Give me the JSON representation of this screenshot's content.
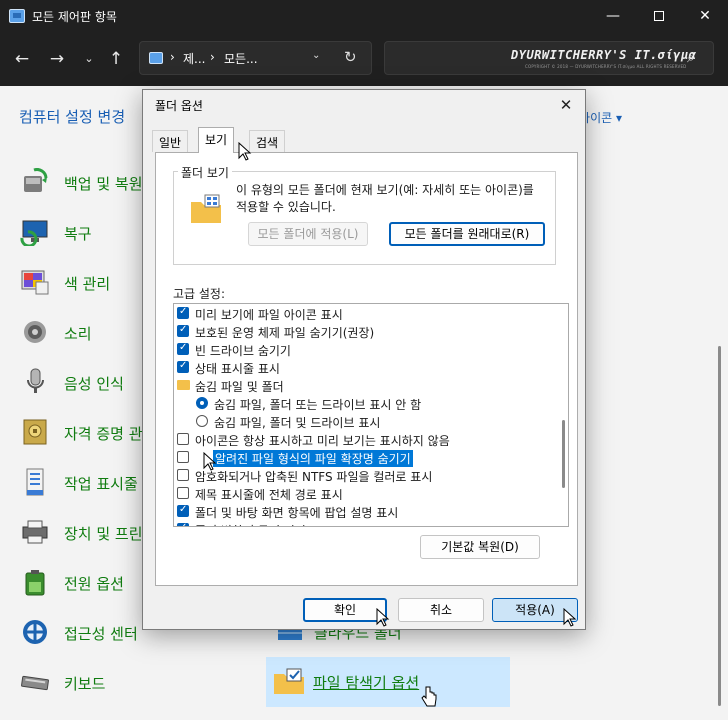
{
  "window": {
    "title": "모든 제어판 항목",
    "min_glyph": "—",
    "close_glyph": "✕"
  },
  "nav": {
    "back": "←",
    "forward": "→",
    "recent": "⌄",
    "up": "↑",
    "breadcrumb": [
      "제...",
      "모든..."
    ],
    "separator": "›",
    "dropdown": "⌄",
    "refresh": "↻",
    "search_text": "DYURWITCHERRY'S IT.σίγμα",
    "search_subtext": "COPYRIGHT © 2018 — DYURWITCHERRY'S IT.σίγμα ALL RIGHTS RESERVED",
    "search_glyph": "⌕"
  },
  "control_panel": {
    "heading": "컴퓨터 설정 변경",
    "view_by": "│ 아이콘 ▾",
    "items": [
      {
        "label": "백업 및 복원",
        "icon": "backup-icon"
      },
      {
        "label": "복구",
        "icon": "recovery-icon"
      },
      {
        "label": "색 관리",
        "icon": "color-management-icon"
      },
      {
        "label": "소리",
        "icon": "sound-icon"
      },
      {
        "label": "음성 인식",
        "icon": "microphone-icon"
      },
      {
        "label": "자격 증명 관리자",
        "icon": "credential-icon"
      },
      {
        "label": "작업 표시줄",
        "icon": "taskbar-icon"
      },
      {
        "label": "장치 및 프린터",
        "icon": "printer-icon"
      },
      {
        "label": "전원 옵션",
        "icon": "power-icon"
      },
      {
        "label": "접근성 센터",
        "icon": "accessibility-icon"
      },
      {
        "label": "키보드",
        "icon": "keyboard-icon"
      }
    ],
    "work_folder": "클라우드 폴더",
    "file_explorer_options": "파일 탐색기 옵션"
  },
  "dialog": {
    "title": "폴더 옵션",
    "close_glyph": "✕",
    "tabs": [
      "일반",
      "보기",
      "검색"
    ],
    "active_tab": "보기",
    "folder_view": {
      "label": "폴더 보기",
      "description": "이 유형의 모든 폴더에 현재 보기(예: 자세히 또는 아이콘)를 적용할 수 있습니다.",
      "apply_button": "모든 폴더에 적용(L)",
      "reset_button": "모든 폴더를 원래대로(R)"
    },
    "advanced_label": "고급 설정:",
    "options": [
      {
        "kind": "check",
        "checked": true,
        "indent": 0,
        "label": "미리 보기에 파일 아이콘 표시"
      },
      {
        "kind": "check",
        "checked": true,
        "indent": 0,
        "label": "보호된 운영 체제 파일 숨기기(권장)"
      },
      {
        "kind": "check",
        "checked": true,
        "indent": 0,
        "label": "빈 드라이브 숨기기"
      },
      {
        "kind": "check",
        "checked": true,
        "indent": 0,
        "label": "상태 표시줄 표시"
      },
      {
        "kind": "folder",
        "checked": false,
        "indent": 0,
        "label": "숨김 파일 및 폴더"
      },
      {
        "kind": "radio",
        "checked": true,
        "indent": 1,
        "label": "숨김 파일, 폴더 또는 드라이브 표시 안 함"
      },
      {
        "kind": "radio",
        "checked": false,
        "indent": 1,
        "label": "숨김 파일, 폴더 및 드라이브 표시"
      },
      {
        "kind": "check",
        "checked": false,
        "indent": 0,
        "label": "아이콘은 항상 표시하고 미리 보기는 표시하지 않음"
      },
      {
        "kind": "check",
        "checked": false,
        "indent": 0,
        "label": "알려진 파일 형식의 파일 확장명 숨기기",
        "selected": true
      },
      {
        "kind": "check",
        "checked": false,
        "indent": 0,
        "label": "암호화되거나 압축된 NTFS 파일을 컬러로 표시"
      },
      {
        "kind": "check",
        "checked": false,
        "indent": 0,
        "label": "제목 표시줄에 전체 경로 표시"
      },
      {
        "kind": "check",
        "checked": true,
        "indent": 0,
        "label": "폴더 및 바탕 화면 항목에 팝업 설명 표시"
      },
      {
        "kind": "check",
        "checked": true,
        "indent": 0,
        "label": "폴더 병합 충돌 숨기기"
      }
    ],
    "restore_defaults": "기본값 복원(D)",
    "ok": "확인",
    "cancel": "취소",
    "apply": "적용(A)"
  },
  "colors": {
    "accent": "#005fb8",
    "link_green": "#107c10",
    "heading_blue": "#1a5fb4",
    "selection": "#0078d7",
    "titlebar": "#202020"
  }
}
